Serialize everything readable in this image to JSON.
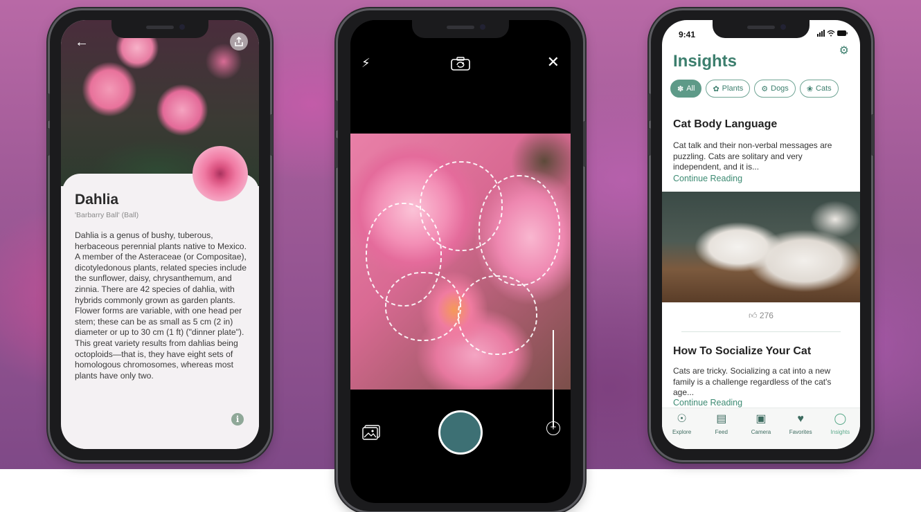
{
  "phone1": {
    "plant_name": "Dahlia",
    "plant_variety": "'Barbarry Ball' (Ball)",
    "description": "Dahlia is a genus of bushy, tuberous, herbaceous perennial plants native to Mexico. A member of the Asteraceae (or Compositae), dicotyledonous plants, related species include the sunflower, daisy, chrysanthemum, and zinnia. There are 42 species of dahlia, with hybrids commonly grown as garden plants. Flower forms are variable, with one head per stem; these can be as small as 5 cm (2 in) diameter or up to 30 cm (1 ft) (\"dinner plate\"). This great variety results from dahlias being octoploids—that is, they have eight sets of homologous chromosomes, whereas most plants have only two.",
    "back_icon": "arrow-left-icon",
    "share_icon": "share-icon",
    "info_icon": "info-icon"
  },
  "phone2": {
    "flash_icon": "flash-icon",
    "flip_icon": "camera-flip-icon",
    "close_icon": "close-icon",
    "gallery_icon": "gallery-icon",
    "zoom_icon": "plus-icon",
    "shutter_color": "#3d7074"
  },
  "phone3": {
    "status_time": "9:41",
    "title": "Insights",
    "chips": [
      {
        "label": "All",
        "icon": "paw-icon",
        "active": true
      },
      {
        "label": "Plants",
        "icon": "flower-icon",
        "active": false
      },
      {
        "label": "Dogs",
        "icon": "bone-icon",
        "active": false
      },
      {
        "label": "Cats",
        "icon": "cat-icon",
        "active": false
      }
    ],
    "articles": [
      {
        "title": "Cat Body Language",
        "body": "Cat talk and their non-verbal messages are puzzling. Cats are solitary and very independent, and it is...",
        "link": "Continue Reading",
        "likes": "276"
      },
      {
        "title": "How To Socialize Your Cat",
        "body": "Cats are tricky. Socializing a cat into a new family is a challenge regardless of the cat's age...",
        "link": "Continue Reading"
      }
    ],
    "tabs": [
      {
        "label": "Explore",
        "icon": "compass-icon"
      },
      {
        "label": "Feed",
        "icon": "feed-icon"
      },
      {
        "label": "Camera",
        "icon": "camera-icon"
      },
      {
        "label": "Favorites",
        "icon": "heart-icon"
      },
      {
        "label": "Insights",
        "icon": "lightbulb-icon"
      }
    ],
    "accent_color": "#3c7e6d"
  }
}
